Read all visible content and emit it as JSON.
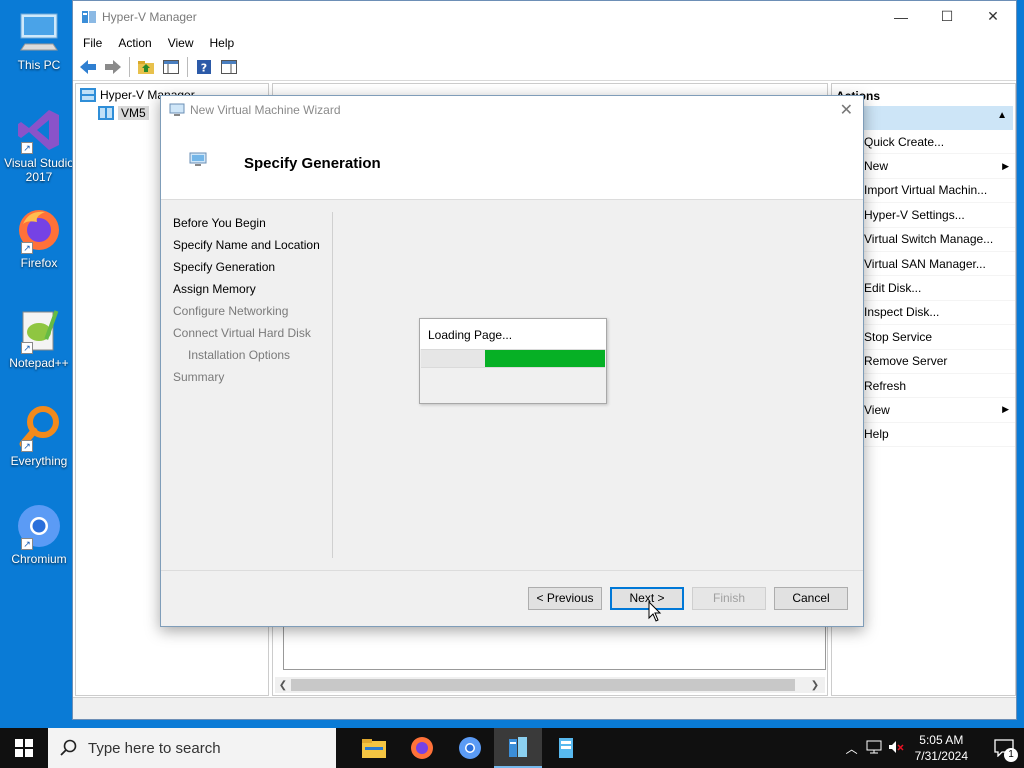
{
  "desktop": {
    "icons": [
      {
        "label": "This PC"
      },
      {
        "label": "Visual Studio 2017"
      },
      {
        "label": "Firefox"
      },
      {
        "label": "Notepad++"
      },
      {
        "label": "Everything"
      },
      {
        "label": "Chromium"
      }
    ]
  },
  "main_window": {
    "title": "Hyper-V Manager",
    "menu": [
      "File",
      "Action",
      "View",
      "Help"
    ],
    "tree": {
      "root": "Hyper-V Manager",
      "child": "VM5"
    },
    "actions": {
      "header": "Actions",
      "items": [
        {
          "label": "Quick Create..."
        },
        {
          "label": "New"
        },
        {
          "label": "Import Virtual Machin..."
        },
        {
          "label": "Hyper-V Settings..."
        },
        {
          "label": "Virtual Switch Manage..."
        },
        {
          "label": "Virtual SAN Manager..."
        },
        {
          "label": "Edit Disk..."
        },
        {
          "label": "Inspect Disk..."
        },
        {
          "label": "Stop Service"
        },
        {
          "label": "Remove Server"
        },
        {
          "label": "Refresh"
        },
        {
          "label": "View"
        },
        {
          "label": "Help"
        }
      ]
    }
  },
  "wizard": {
    "title": "New Virtual Machine Wizard",
    "heading": "Specify Generation",
    "steps": [
      {
        "label": "Before You Begin"
      },
      {
        "label": "Specify Name and Location"
      },
      {
        "label": "Specify Generation"
      },
      {
        "label": "Assign Memory"
      },
      {
        "label": "Configure Networking"
      },
      {
        "label": "Connect Virtual Hard Disk"
      },
      {
        "label": "Installation Options"
      },
      {
        "label": "Summary"
      }
    ],
    "loading_text": "Loading Page...",
    "progress_fraction": 0.65,
    "buttons": {
      "previous": "< Previous",
      "next": "Next >",
      "finish": "Finish",
      "cancel": "Cancel"
    }
  },
  "taskbar": {
    "search_placeholder": "Type here to search",
    "time": "5:05 AM",
    "date": "7/31/2024",
    "notification_count": "1"
  },
  "colors": {
    "desktop": "#0a7bd6",
    "progress_fill": "#06b025",
    "accent": "#0078d7"
  }
}
